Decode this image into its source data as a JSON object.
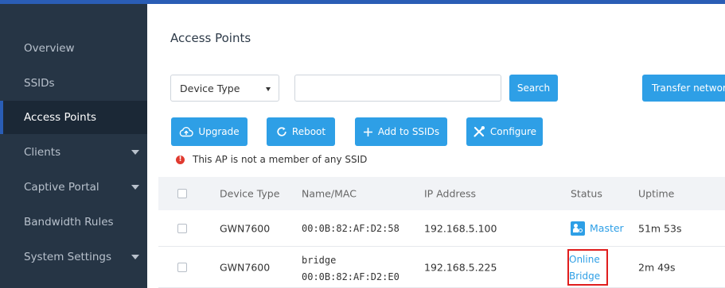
{
  "sidebar": {
    "items": [
      {
        "label": "Overview"
      },
      {
        "label": "SSIDs"
      },
      {
        "label": "Access Points"
      },
      {
        "label": "Clients"
      },
      {
        "label": "Captive Portal"
      },
      {
        "label": "Bandwidth Rules"
      },
      {
        "label": "System Settings"
      }
    ],
    "active": "Access Points"
  },
  "page": {
    "title": "Access Points"
  },
  "filter": {
    "select_value": "Device Type",
    "search_value": "",
    "search_button": "Search",
    "transfer_button": "Transfer network"
  },
  "toolbar": {
    "upgrade": "Upgrade",
    "reboot": "Reboot",
    "add_to_ssids": "Add to SSIDs",
    "configure": "Configure"
  },
  "warning": {
    "text": "This AP is not a member of any SSID",
    "icon": "exclamation-icon"
  },
  "table": {
    "headers": {
      "device_type": "Device Type",
      "name_mac": "Name/MAC",
      "ip": "IP Address",
      "status": "Status",
      "uptime": "Uptime"
    },
    "rows": [
      {
        "device_type": "GWN7600",
        "name": "",
        "mac": "00:0B:82:AF:D2:58",
        "ip": "192.168.5.100",
        "status": "Master",
        "uptime": "51m 53s"
      },
      {
        "device_type": "GWN7600",
        "name": "bridge",
        "mac": "00:0B:82:AF:D2:E0",
        "ip": "192.168.5.225",
        "status_line1": "Online",
        "status_line2": "Bridge",
        "uptime": "2m 49s"
      }
    ]
  },
  "colors": {
    "accent": "#2e9fe6",
    "sidebar_bg": "#263545",
    "highlight": "#e01d1d",
    "warning": "#e03a2f"
  }
}
